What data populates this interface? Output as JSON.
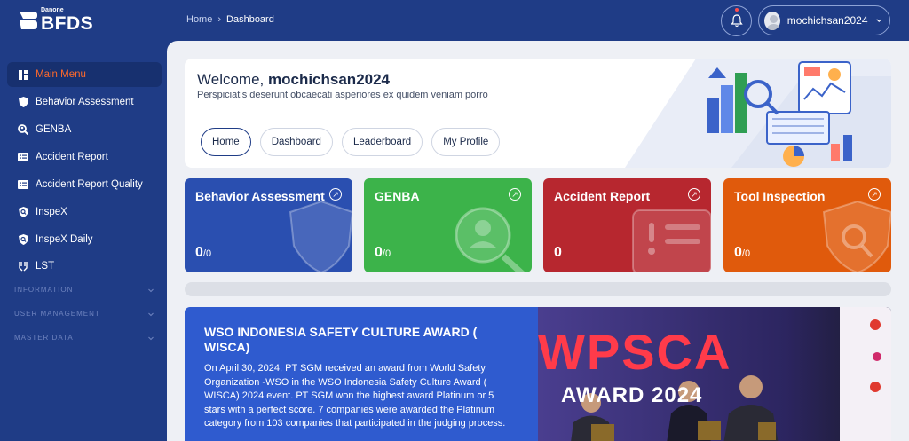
{
  "logo": {
    "brand": "Danone",
    "name": "BFDS"
  },
  "breadcrumb": {
    "home": "Home",
    "current": "Dashboard"
  },
  "user": {
    "name": "mochichsan2024"
  },
  "sidebar": {
    "items": [
      {
        "label": "Main Menu",
        "icon": "grid-icon"
      },
      {
        "label": "Behavior Assessment",
        "icon": "shield-icon"
      },
      {
        "label": "GENBA",
        "icon": "search-person-icon"
      },
      {
        "label": "Accident Report",
        "icon": "report-icon"
      },
      {
        "label": "Accident Report Quality",
        "icon": "report-icon"
      },
      {
        "label": "InspeX",
        "icon": "shield-search-icon"
      },
      {
        "label": "InspeX Daily",
        "icon": "shield-search-icon"
      },
      {
        "label": "LST",
        "icon": "hands-icon"
      }
    ],
    "sections": [
      "INFORMATION",
      "USER MANAGEMENT",
      "MASTER DATA"
    ]
  },
  "welcome": {
    "greeting": "Welcome,",
    "username": "mochichsan2024",
    "subtitle": "Perspiciatis deserunt obcaecati asperiores ex quidem veniam porro",
    "tabs": [
      "Home",
      "Dashboard",
      "Leaderboard",
      "My Profile"
    ]
  },
  "cards": [
    {
      "title": "Behavior Assessment",
      "value": "0",
      "total": "/0",
      "color": "#2a4fb0"
    },
    {
      "title": "GENBA",
      "value": "0",
      "total": "/0",
      "color": "#3cb34a"
    },
    {
      "title": "Accident Report",
      "value": "0",
      "total": "",
      "color": "#b7272f"
    },
    {
      "title": "Tool Inspection",
      "value": "0",
      "total": "/0",
      "color": "#e05a0c"
    }
  ],
  "news": {
    "title": "WSO INDONESIA SAFETY CULTURE AWARD ( WISCA)",
    "body": "On April 30, 2024, PT SGM received an award from World Safety Organization -WSO in the WSO Indonesia Safety Culture Award ( WISCA) 2024 event. PT SGM won the highest award Platinum or 5 stars with a perfect score. 7 companies were awarded the Platinum category from 103 companies that participated in the judging process.",
    "photo_banner": "WPSCA",
    "photo_year": "AWARD 2024"
  }
}
